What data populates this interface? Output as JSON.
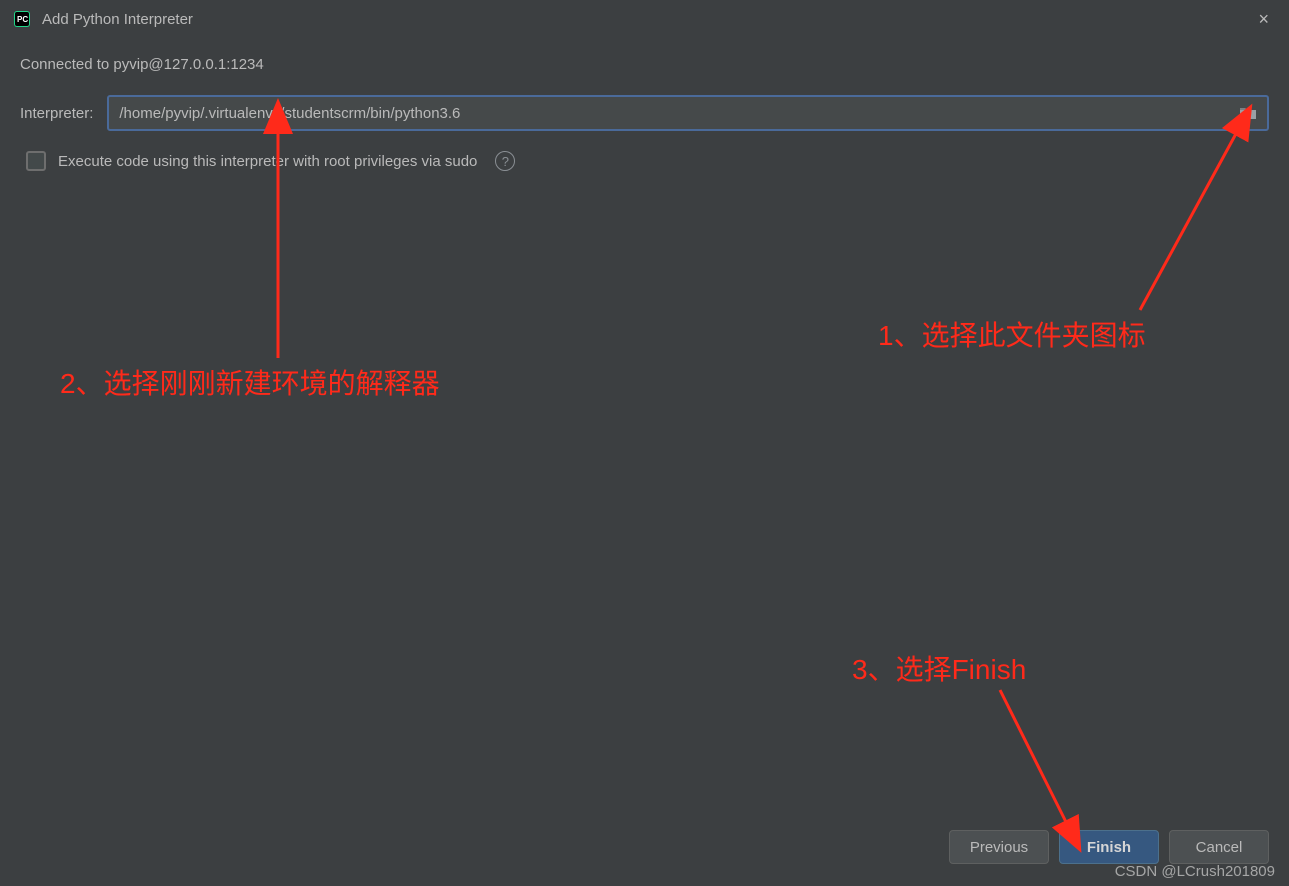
{
  "dialog": {
    "title": "Add Python Interpreter",
    "close_label": "×"
  },
  "connection": {
    "text": "Connected to pyvip@127.0.0.1:1234"
  },
  "interpreter": {
    "label": "Interpreter:",
    "value": "/home/pyvip/.virtualenvs/studentscrm/bin/python3.6"
  },
  "sudo": {
    "label": "Execute code using this interpreter with root privileges via sudo",
    "help": "?"
  },
  "buttons": {
    "previous": "Previous",
    "finish": "Finish",
    "cancel": "Cancel"
  },
  "annotations": {
    "a1": "1、选择此文件夹图标",
    "a2": "2、选择刚刚新建环境的解释器",
    "a3": "3、选择Finish"
  },
  "watermark": "CSDN @LCrush201809",
  "colors": {
    "annotation": "#ff2a1a",
    "background": "#3c3f41",
    "input_border": "#4a6a9a",
    "primary_button": "#365880"
  }
}
